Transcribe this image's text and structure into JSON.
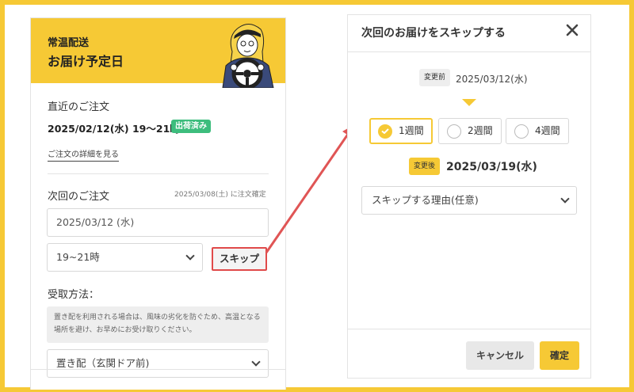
{
  "left": {
    "header": {
      "subtitle": "常温配送",
      "title": "お届け予定日"
    },
    "recent_order": {
      "label": "直近のご注文",
      "date": "2025/02/12(水) 19〜21時",
      "status_badge": "出荷済み",
      "detail_link": "ご注文の詳細を見る"
    },
    "next_order": {
      "label": "次回のご注文",
      "confirm_note": "2025/03/08(土) に注文確定",
      "date_value": "2025/03/12 (水)",
      "time_value": "19~21時",
      "skip_button": "スキップ"
    },
    "receive": {
      "label": "受取方法：",
      "note": "置き配を利用される場合は、風味の劣化を防ぐため、高温となる場所を避け、お早めにお受け取りください。",
      "method_value": "置き配（玄関ドア前)"
    }
  },
  "modal": {
    "title": "次回のお届けをスキップする",
    "before_tag": "変更前",
    "before_date": "2025/03/12(水)",
    "week_options": [
      {
        "label": "1週間",
        "selected": true
      },
      {
        "label": "2週間",
        "selected": false
      },
      {
        "label": "4週間",
        "selected": false
      }
    ],
    "after_tag": "変更後",
    "after_date": "2025/03/19(水)",
    "reason_placeholder": "スキップする理由(任意)",
    "cancel_button": "キャンセル",
    "confirm_button": "確定"
  },
  "colors": {
    "accent": "#f6c935",
    "badge_green": "#3dbd7d",
    "highlight_red": "#e04a4a"
  },
  "icons": [
    "check-icon",
    "close-icon",
    "chevron-down-icon",
    "arrow-icon"
  ]
}
